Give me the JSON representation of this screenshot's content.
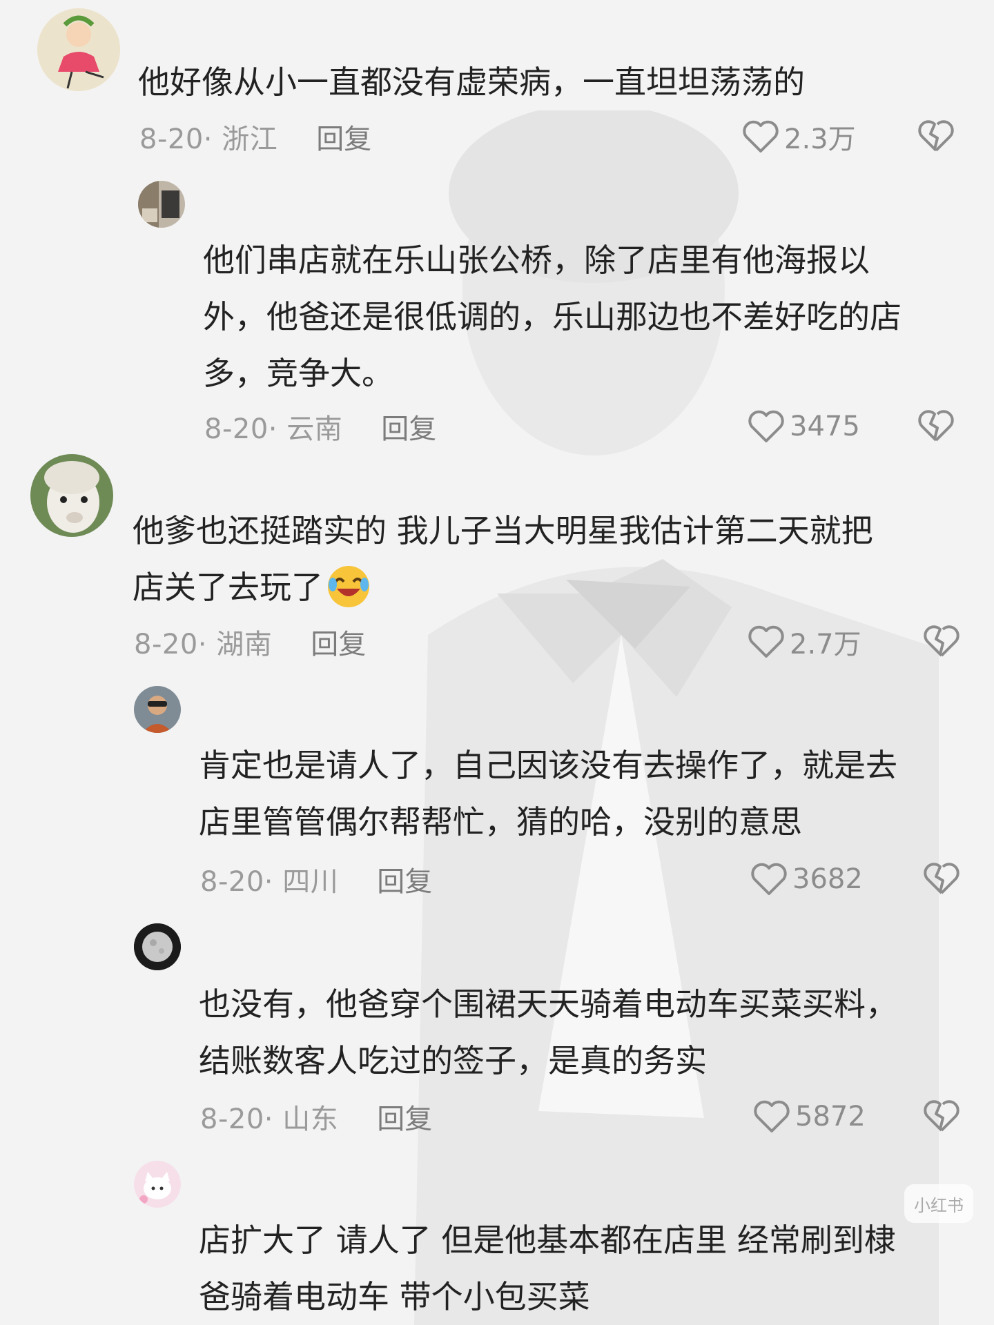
{
  "comments": [
    {
      "text_lines": [
        "他好像从小一直都没有虚荣病，一直坦坦荡荡的"
      ],
      "date": "8-20· 浙江",
      "reply": "回复",
      "likes": "2.3万",
      "avatar": "girl-dancer-avatar"
    },
    {
      "text_lines": [
        "他们串店就在乐山张公桥，除了店里有他海报以",
        "外，他爸还是很低调的，乐山那边也不差好吃的店",
        "多，竞争大。"
      ],
      "date": "8-20· 云南",
      "reply": "回复",
      "likes": "3475",
      "avatar": "room-photo-avatar"
    },
    {
      "text_lines": [
        "他爹也还挺踏实的 我儿子当大明星我估计第二天就把",
        "店关了去玩了"
      ],
      "date": "8-20· 湖南",
      "reply": "回复",
      "likes": "2.7万",
      "avatar": "alpaca-avatar"
    },
    {
      "text_lines": [
        "肯定也是请人了，自己因该没有去操作了，就是去",
        "店里管管偶尔帮帮忙，猜的哈，没别的意思"
      ],
      "date": "8-20· 四川",
      "reply": "回复",
      "likes": "3682",
      "avatar": "person-photo-avatar"
    },
    {
      "text_lines": [
        "也没有，他爸穿个围裙天天骑着电动车买菜买料，",
        "结账数客人吃过的签子，是真的务实"
      ],
      "date": "8-20· 山东",
      "reply": "回复",
      "likes": "5872",
      "avatar": "moon-avatar"
    },
    {
      "text_lines": [
        "店扩大了 请人了 但是他基本都在店里 经常刷到棣",
        "爸骑着电动车 带个小包买菜"
      ],
      "avatar": "cartoon-cat-avatar"
    }
  ],
  "watermark": "小红书",
  "icons": {
    "like": "heart-outline-icon",
    "dislike": "broken-heart-icon",
    "emoji": "laughing-crying-emoji"
  },
  "colors": {
    "background": "#f3f3f3",
    "text": "#222222",
    "meta": "#9a9a9a"
  }
}
